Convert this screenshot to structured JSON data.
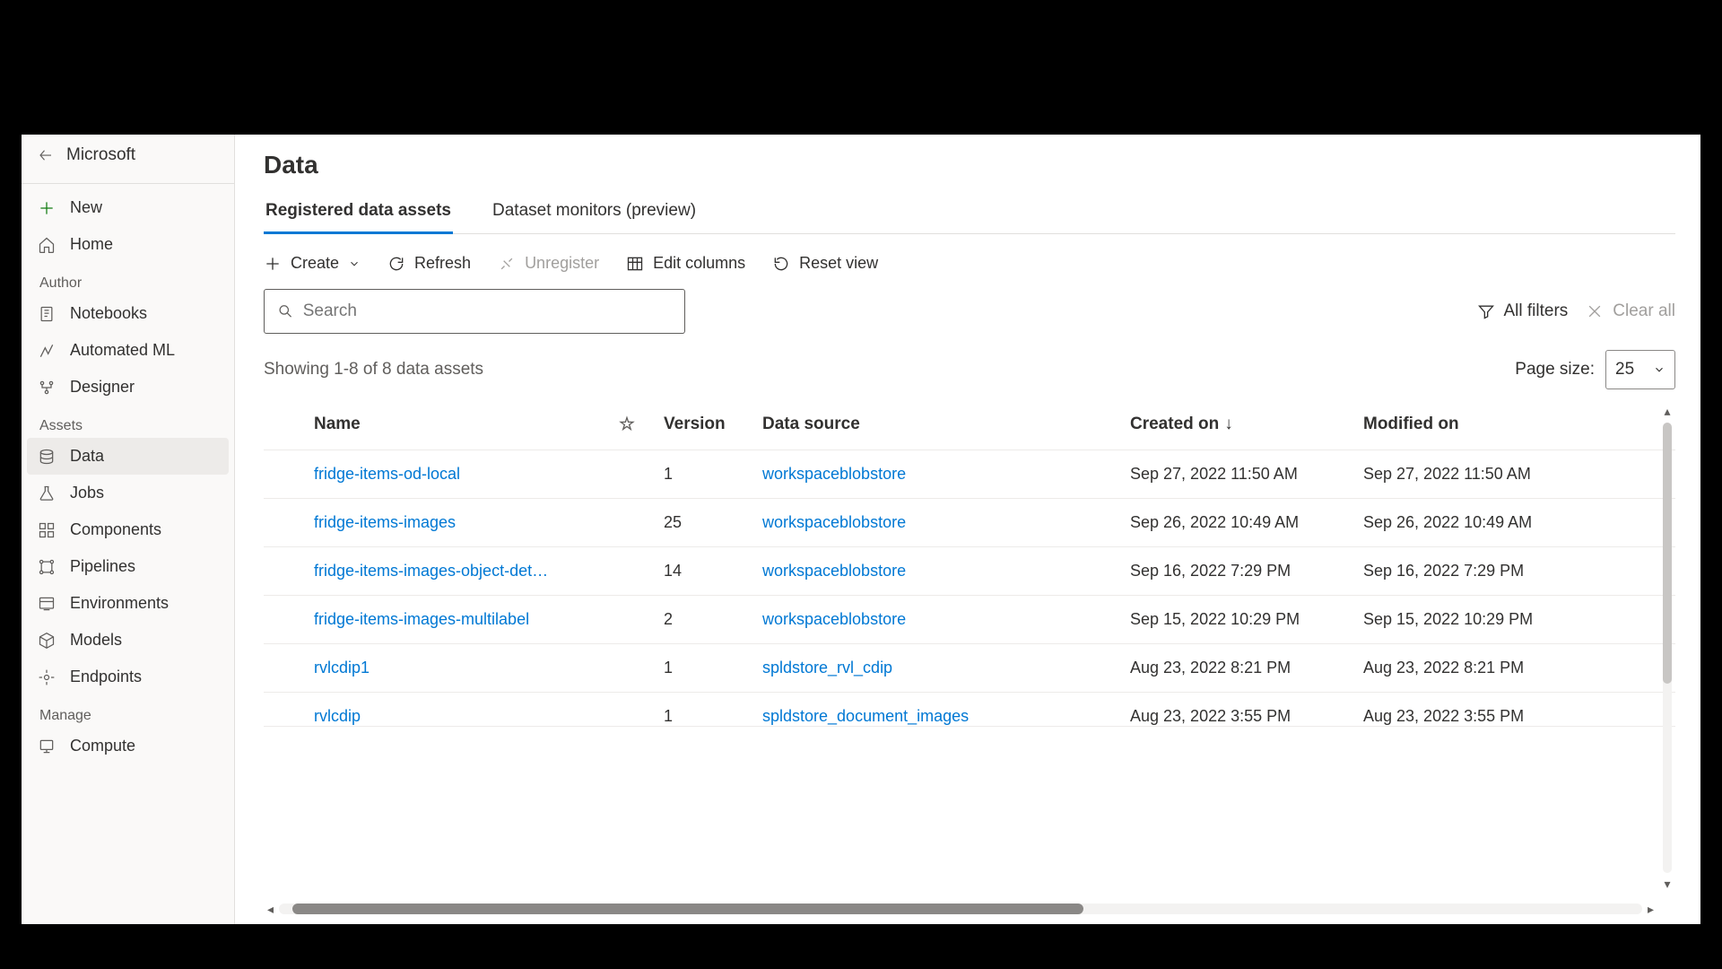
{
  "header": {
    "workspace": "Microsoft"
  },
  "sidebar": {
    "new": "New",
    "home": "Home",
    "groups": {
      "author": "Author",
      "assets": "Assets",
      "manage": "Manage"
    },
    "author_items": {
      "notebooks": "Notebooks",
      "automl": "Automated ML",
      "designer": "Designer"
    },
    "assets_items": {
      "data": "Data",
      "jobs": "Jobs",
      "components": "Components",
      "pipelines": "Pipelines",
      "environments": "Environments",
      "models": "Models",
      "endpoints": "Endpoints"
    },
    "manage_items": {
      "compute": "Compute"
    }
  },
  "page": {
    "title": "Data",
    "tabs": {
      "registered": "Registered data assets",
      "monitors": "Dataset monitors (preview)"
    }
  },
  "toolbar": {
    "create": "Create",
    "refresh": "Refresh",
    "unregister": "Unregister",
    "editcols": "Edit columns",
    "resetview": "Reset view"
  },
  "search": {
    "placeholder": "Search"
  },
  "filters": {
    "all": "All filters",
    "clear": "Clear all"
  },
  "status": {
    "showing": "Showing 1-8 of 8 data assets",
    "page_size_label": "Page size:",
    "page_size_value": "25"
  },
  "columns": {
    "name": "Name",
    "version": "Version",
    "source": "Data source",
    "created": "Created on",
    "modified": "Modified on"
  },
  "rows": [
    {
      "name": "fridge-items-od-local",
      "version": "1",
      "source": "workspaceblobstore",
      "created": "Sep 27, 2022 11:50 AM",
      "modified": "Sep 27, 2022 11:50 AM"
    },
    {
      "name": "fridge-items-images",
      "version": "25",
      "source": "workspaceblobstore",
      "created": "Sep 26, 2022 10:49 AM",
      "modified": "Sep 26, 2022 10:49 AM"
    },
    {
      "name": "fridge-items-images-object-det…",
      "version": "14",
      "source": "workspaceblobstore",
      "created": "Sep 16, 2022 7:29 PM",
      "modified": "Sep 16, 2022 7:29 PM"
    },
    {
      "name": "fridge-items-images-multilabel",
      "version": "2",
      "source": "workspaceblobstore",
      "created": "Sep 15, 2022 10:29 PM",
      "modified": "Sep 15, 2022 10:29 PM"
    },
    {
      "name": "rvlcdip1",
      "version": "1",
      "source": "spldstore_rvl_cdip",
      "created": "Aug 23, 2022 8:21 PM",
      "modified": "Aug 23, 2022 8:21 PM"
    },
    {
      "name": "rvlcdip",
      "version": "1",
      "source": "spldstore_document_images",
      "created": "Aug 23, 2022 3:55 PM",
      "modified": "Aug 23, 2022 3:55 PM"
    }
  ]
}
